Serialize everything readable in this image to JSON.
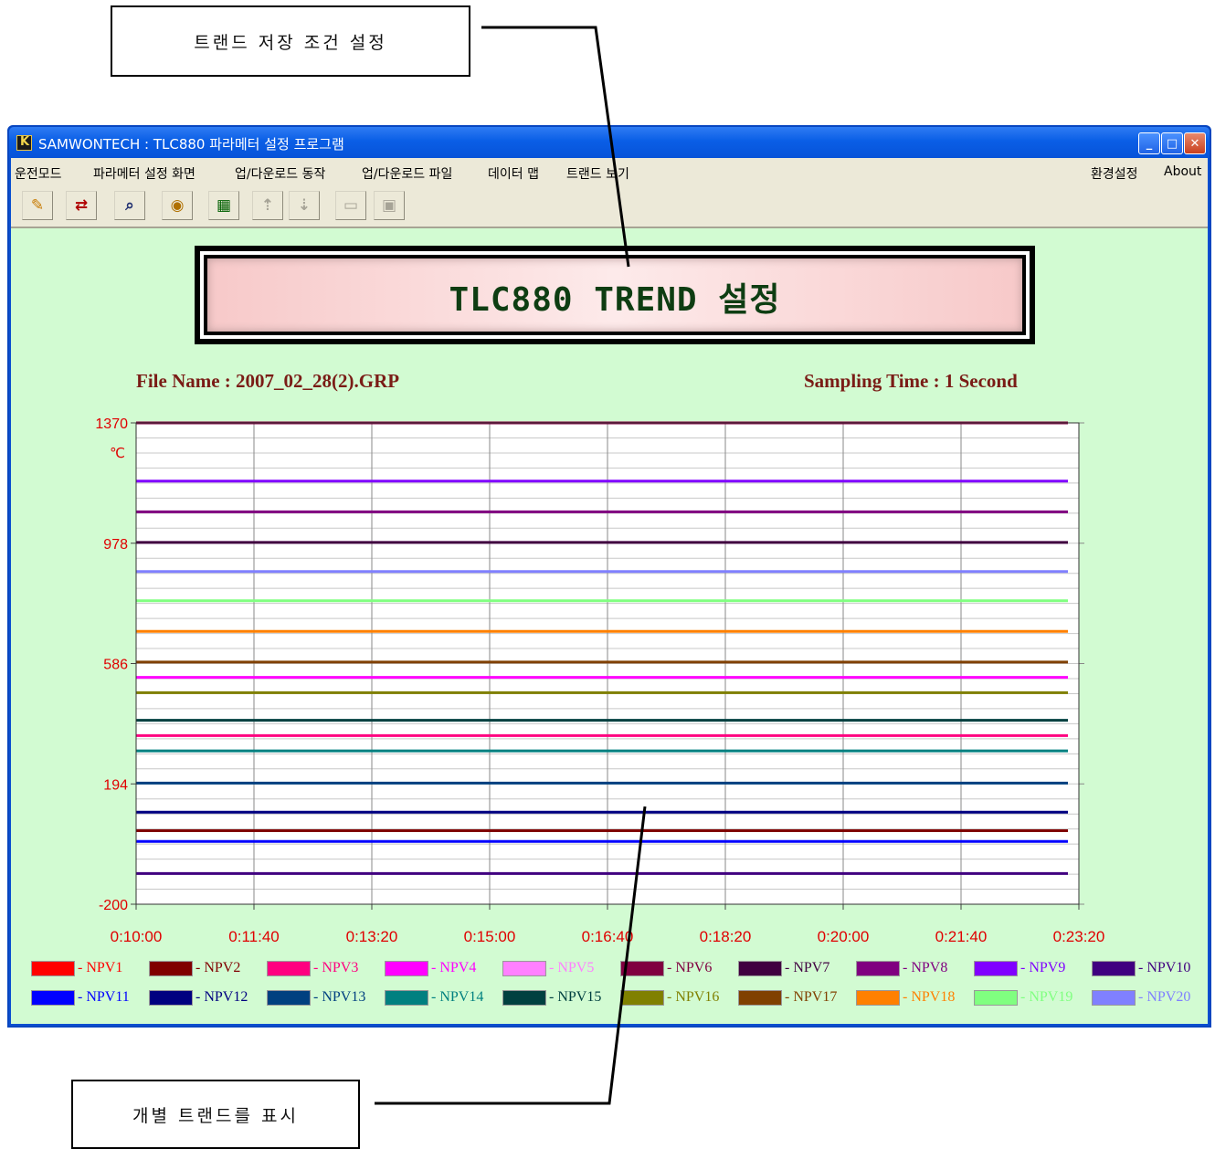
{
  "callouts": {
    "top": "트랜드 저장 조건 설정",
    "bottom": "개별 트랜드를 표시"
  },
  "window": {
    "title": "SAMWONTECH : TLC880 파라메터 설정 프로그램",
    "buttons": {
      "minimize": "_",
      "maximize": "□",
      "close": "✕"
    }
  },
  "menu": {
    "items": [
      "운전모드",
      "파라메터 설정 화면",
      "업/다운로드 동작",
      "업/다운로드 파일",
      "데이터 맵",
      "트랜드 보기"
    ],
    "right": [
      "환경설정",
      "About"
    ]
  },
  "toolbar": {
    "buttons": [
      {
        "icon": "edit-icon",
        "enabled": true
      },
      {
        "icon": "transfer-icon",
        "enabled": true
      },
      {
        "icon": "preview-icon",
        "enabled": true
      },
      {
        "icon": "trend-icon",
        "enabled": true
      },
      {
        "icon": "grid-icon",
        "enabled": true
      },
      {
        "icon": "upload-icon",
        "enabled": false
      },
      {
        "icon": "download-icon",
        "enabled": false
      },
      {
        "icon": "open-folder-icon",
        "enabled": false
      },
      {
        "icon": "save-icon",
        "enabled": false
      }
    ]
  },
  "banner": {
    "title": "TLC880 TREND 설정"
  },
  "info": {
    "file_name": "File Name : 2007_02_28(2).GRP",
    "sampling_time": "Sampling Time : 1 Second"
  },
  "chart_data": {
    "type": "line",
    "unit": "℃",
    "ylim": [
      -200,
      1370
    ],
    "y_ticks": [
      "1370",
      "978",
      "586",
      "194",
      "-200"
    ],
    "x_ticks": [
      "0:10:00",
      "0:11:40",
      "0:13:20",
      "0:15:00",
      "0:16:40",
      "0:18:20",
      "0:20:00",
      "0:21:40",
      "0:23:20"
    ],
    "grid": true,
    "series": [
      {
        "name": "NPV1",
        "color": "#ff0000",
        "value": null
      },
      {
        "name": "NPV2",
        "color": "#800000",
        "value": 40
      },
      {
        "name": "NPV3",
        "color": "#ff0080",
        "value": 350
      },
      {
        "name": "NPV4",
        "color": "#ff00ff",
        "value": 540
      },
      {
        "name": "NPV5",
        "color": "#ff80ff",
        "value": null
      },
      {
        "name": "NPV6",
        "color": "#800040",
        "value": 1370
      },
      {
        "name": "NPV7",
        "color": "#400040",
        "value": 980
      },
      {
        "name": "NPV8",
        "color": "#800080",
        "value": 1080
      },
      {
        "name": "NPV9",
        "color": "#8000ff",
        "value": 1180
      },
      {
        "name": "NPV10",
        "color": "#400080",
        "value": -100
      },
      {
        "name": "NPV11",
        "color": "#0000ff",
        "value": 5
      },
      {
        "name": "NPV12",
        "color": "#000080",
        "value": 100
      },
      {
        "name": "NPV13",
        "color": "#004080",
        "value": 195
      },
      {
        "name": "NPV14",
        "color": "#008080",
        "value": 300
      },
      {
        "name": "NPV15",
        "color": "#004040",
        "value": 400
      },
      {
        "name": "NPV16",
        "color": "#808000",
        "value": 490
      },
      {
        "name": "NPV17",
        "color": "#804000",
        "value": 590
      },
      {
        "name": "NPV18",
        "color": "#ff8000",
        "value": 690
      },
      {
        "name": "NPV19",
        "color": "#80ff80",
        "value": 790
      },
      {
        "name": "NPV20",
        "color": "#8080ff",
        "value": 885
      }
    ]
  }
}
